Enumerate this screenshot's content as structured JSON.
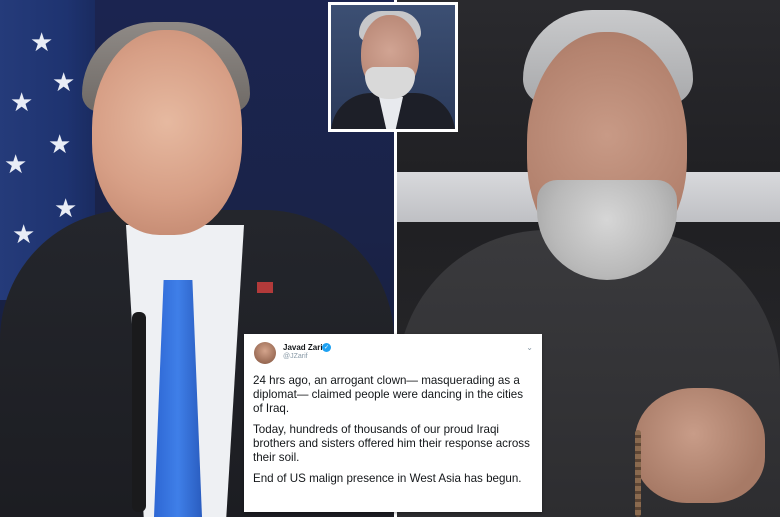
{
  "photos": {
    "left": {
      "subject": "man-in-suit-blue-tie"
    },
    "right": {
      "subject": "man-with-beard-dark-suit"
    },
    "inset": {
      "subject": "man-with-glasses"
    }
  },
  "tweet": {
    "author_name": "Javad Zarif",
    "author_handle": "@JZarif",
    "verified_icon": "verified-badge-icon",
    "paragraphs": [
      "24 hrs ago, an arrogant clown— masquerading as a diplomat— claimed people were dancing in the cities of Iraq.",
      "Today, hundreds of thousands of our proud Iraqi brothers and sisters offered him their response across their soil.",
      "End of US malign presence in West Asia has begun."
    ]
  },
  "colors": {
    "tweet_background": "#ffffff",
    "verified_blue": "#1da1f2",
    "text": "#14171a"
  }
}
